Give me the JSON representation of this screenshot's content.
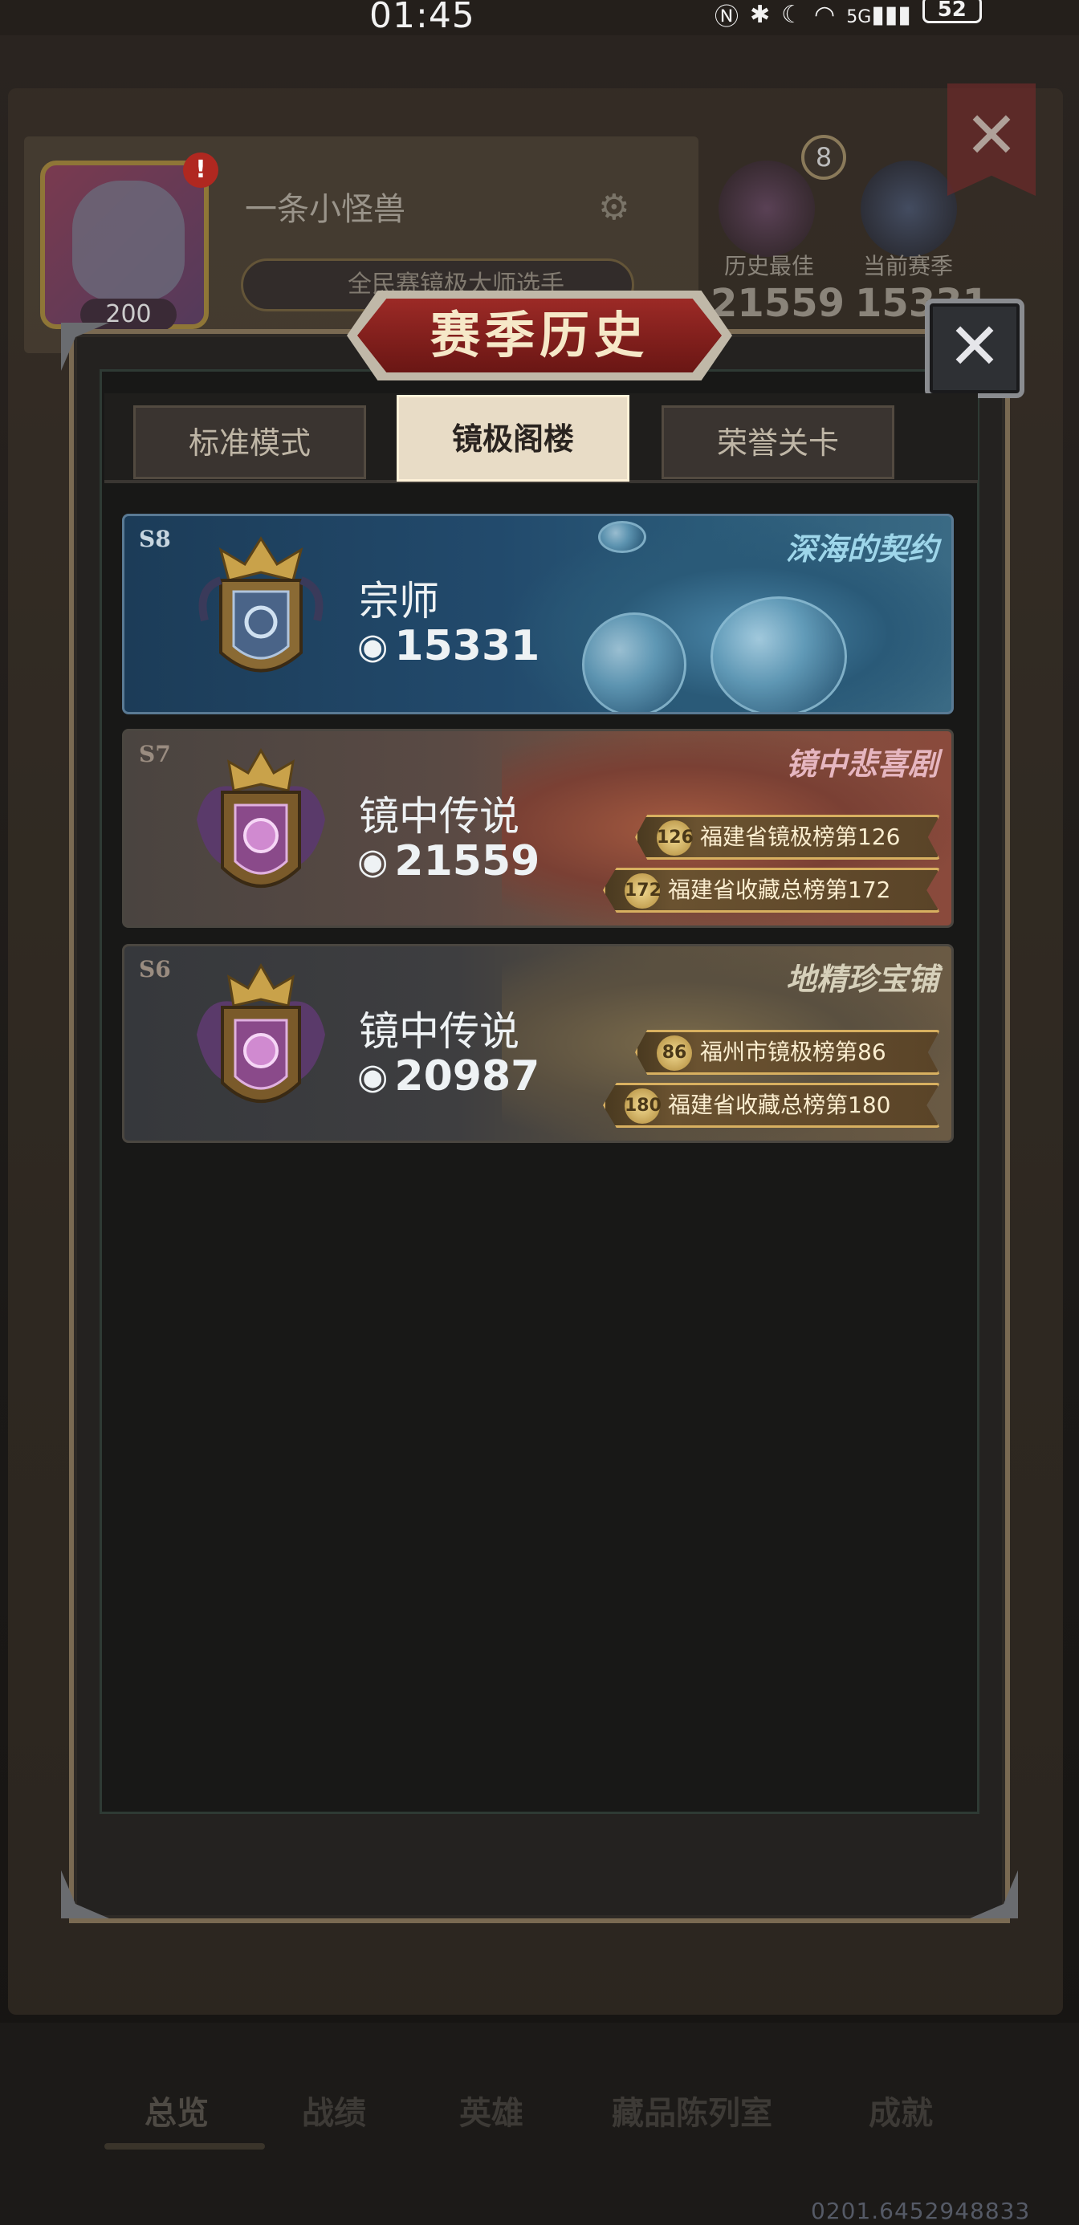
{
  "status_bar": {
    "time": "01:45",
    "icons": [
      "nfc-icon",
      "bluetooth-icon",
      "moon-icon",
      "wifi-icon",
      "signal-icon"
    ],
    "network_label": "5G",
    "battery": "52"
  },
  "background": {
    "player_name": "一条小怪兽",
    "avatar_level": "200",
    "alert": "!",
    "title_chip": "全民赛镜极大师选手",
    "rank_count": "8",
    "best_label": "历史最佳",
    "best_value": "21559",
    "current_label": "当前赛季",
    "current_value": "15331",
    "close_symbol": "✕"
  },
  "modal": {
    "title": "赛季历史",
    "close_symbol": "✕",
    "tabs": [
      {
        "label": "标准模式",
        "active": false
      },
      {
        "label": "镜极阁楼",
        "active": true
      },
      {
        "label": "荣誉关卡",
        "active": false
      }
    ],
    "seasons": [
      {
        "code": "S8",
        "theme": "深海的契约",
        "rank_name": "宗师",
        "score": "15331",
        "badges": []
      },
      {
        "code": "S7",
        "theme": "镜中悲喜剧",
        "rank_name": "镜中传说",
        "score": "21559",
        "badges": [
          {
            "medal": "126",
            "text": "福建省镜极榜第126"
          },
          {
            "medal": "172",
            "text": "福建省收藏总榜第172"
          }
        ]
      },
      {
        "code": "S6",
        "theme": "地精珍宝铺",
        "rank_name": "镜中传说",
        "score": "20987",
        "badges": [
          {
            "medal": "86",
            "text": "福州市镜极榜第86"
          },
          {
            "medal": "180",
            "text": "福建省收藏总榜第180"
          }
        ]
      }
    ]
  },
  "bottom_nav": {
    "items": [
      "总览",
      "战绩",
      "英雄",
      "藏品陈列室",
      "成就"
    ],
    "active": "总览"
  },
  "build_id": "0201.6452948833",
  "colors": {
    "title_red": "#9c2a26",
    "badge_gold": "#d8b060",
    "s8_blue": "#224a6c"
  }
}
